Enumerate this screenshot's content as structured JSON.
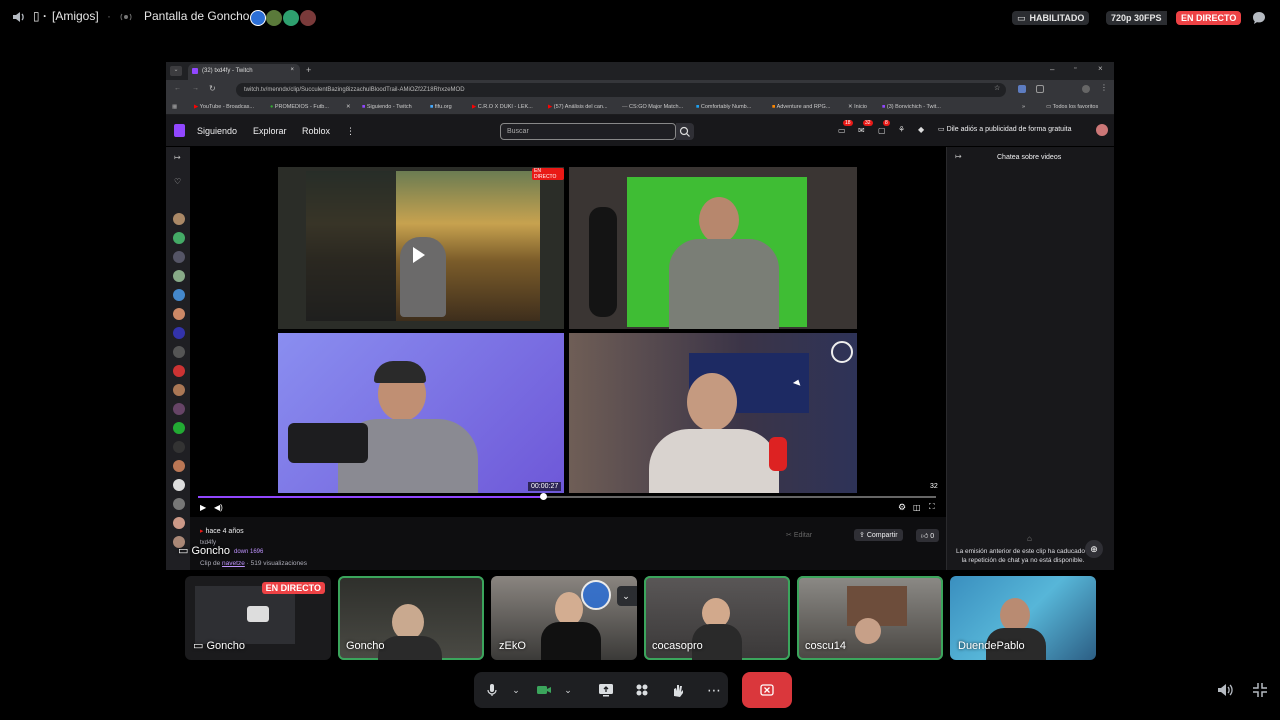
{
  "topbar": {
    "channel_icon": "volume-icon",
    "channel_name": "[Amigos]",
    "stream_title": "Pantalla de Goncho",
    "status_enabled": "HABILITADO",
    "quality": "720p 30FPS",
    "live_label": "EN DIRECTO"
  },
  "browser": {
    "tab_title": "(32) txd4fy - Twitch",
    "url": "twitch.tv/menndx/clip/SucculentBazing8izzachulBloodTrail-AMiOZf2Z18RhxzeMOD",
    "bookmarks": [
      "YouTube - Broadcas...",
      "PROMEDIOS - Futb...",
      "Siguiendo - Twitch",
      "fifu.org",
      "C.R.O X DUKI - LEK...",
      "(57) Análisis del can...",
      "CS:GO Major Match...",
      "Comfortably Numb...",
      "Adventure and RPG...",
      "Inicio",
      "(3) Bonvichich - Twit..."
    ],
    "bookmarks_all": "Todos los favoritos"
  },
  "twitch": {
    "nav_following": "Siguiendo",
    "nav_explore": "Explorar",
    "nav_roblox": "Roblox",
    "search_placeholder": "Buscar",
    "notif_count_1": "18",
    "notif_count_2": "32",
    "notif_count_3": "8",
    "ad_free_text": "Dile adiós a publicidad de forma gratuita",
    "chat_header": "Chatea sobre videos",
    "live_badge": "EN DIRECTO",
    "timestamp": "00:00:27",
    "viewers_small": "32",
    "clip_age": "hace 4 años",
    "clip_channel": "txd4fy",
    "clip_category": "down 1696",
    "clip_by": "Clip de",
    "clip_author": "navetze",
    "clip_views": "· 519 visualizaciones",
    "edit_label": "Editar",
    "share_label": "Compartir",
    "likes": "0",
    "chat_notice": "La emisión anterior de este clip ha caducado y la repetición de chat ya no está disponible."
  },
  "overlay_name": "Goncho",
  "participants": [
    {
      "name": "Goncho",
      "badge": "EN DIRECTO"
    },
    {
      "name": "Goncho"
    },
    {
      "name": "zEkO"
    },
    {
      "name": "cocasopro"
    },
    {
      "name": "coscu14"
    },
    {
      "name": "DuendePablo"
    }
  ],
  "colors": {
    "discord_bg": "#000000",
    "twitch_purple": "#9147ff",
    "live_red": "#ed4245",
    "speaking_green": "#3ba55c",
    "hangup_red": "#da373c"
  }
}
